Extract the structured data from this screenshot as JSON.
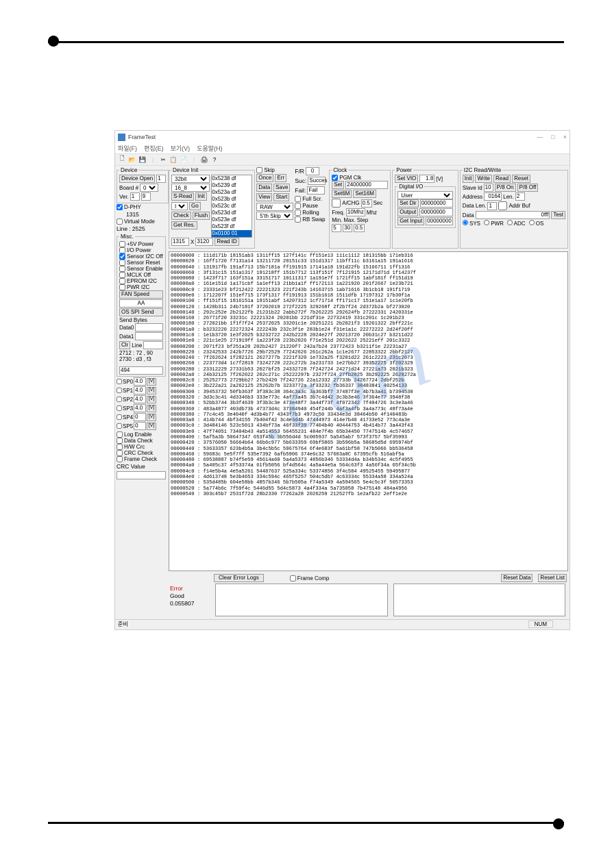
{
  "window": {
    "title": "FrameTest",
    "menus": [
      "파일(F)",
      "편집(E)",
      "보기(V)",
      "도움말(H)"
    ],
    "win_buttons": [
      "—",
      "□",
      "×"
    ]
  },
  "device": {
    "legend": "Device",
    "open_btn": "Device Open",
    "open_val": "1",
    "board_label": "Board #",
    "board_val": "0",
    "ver_label": "Ver.",
    "ver_val1": "1",
    "ver_val2": "9"
  },
  "dphy": {
    "cb_dphy": "D-PHY",
    "val_1315": "1315",
    "cb_virtual": "Virtual Mode",
    "line_label": "Line :",
    "line_val": "2525"
  },
  "misc": {
    "legend": "Misc.",
    "items": [
      "+5V Power",
      "I/O Power",
      "Sensor I2C Off",
      "Sensor Reset",
      "Sensor Enable",
      "MCLK Off",
      "EPROM I2C",
      "PWR I2C"
    ],
    "checked_index": 2,
    "fan_label": "FAN Speed",
    "fan_val": "AA",
    "os_spi_btn": "OS SPI Send",
    "send_bytes_label": "Send Bytes",
    "data0_label": "Data0",
    "data1_label": "Data1",
    "clr_btn": "Clr",
    "line_label": "Line",
    "note1": "2712 : 72 , 90",
    "note2": "2730 : d3 , f3",
    "note3": "494"
  },
  "sp": {
    "rows": [
      {
        "name": "SP0",
        "val": "4.0"
      },
      {
        "name": "SP1",
        "val": "4.0"
      },
      {
        "name": "SP2",
        "val": "4.0"
      },
      {
        "name": "SP3",
        "val": "4.0"
      },
      {
        "name": "SP4",
        "val": "0"
      },
      {
        "name": "SP5",
        "val": "0"
      }
    ],
    "vbtn": "[V]"
  },
  "checks2": {
    "items": [
      "Log Enable",
      "Data Check",
      "H/W Crc",
      "CRC Check",
      "Frame Check"
    ],
    "crc_label": "CRC Value"
  },
  "device_init": {
    "legend": "Device Init",
    "bit_sel": "32bit",
    "fmt_sel": "16_8",
    "sread_btn": "S-Read",
    "init_btn": "Init",
    "ini_sel": "INI",
    "go_btn": "Go",
    "check_btn": "Check",
    "flush_btn": "Flush",
    "getres_btn": "Get Res.",
    "res_w": "1315",
    "res_x": "X",
    "res_h": "3120",
    "list_items": [
      "0x5238 df",
      "0x5239 df",
      "0x523a df",
      "0x523b df",
      "0x523c df",
      "0x523d df",
      "0x523e df",
      "0x523f df",
      "0x0100 01"
    ],
    "readid_btn": "Read ID"
  },
  "mid_controls": {
    "skip_cb": "Skip",
    "once_btn": "Once",
    "err_btn": "Err",
    "data_btn": "Data",
    "save_btn": "Save",
    "view_btn": "View",
    "start_btn": "Start",
    "raw_sel": "RAW",
    "sth_sel": "5'th Skip",
    "fr_label": "F/R",
    "fr_val": "0",
    "suc_label": "Suc:",
    "suc_val": "Succes",
    "fail_label": "Fail:",
    "fail_val": "Fail",
    "fullscr": "Full Scr.",
    "pause": "Pause",
    "rolling": "Rolling",
    "rbswap": "RB Swap"
  },
  "clock": {
    "legend": "Clock",
    "pgmclk": "PGM Clk",
    "set_btn": "Set",
    "set_val": "24000000",
    "set6m_btn": "Set6M",
    "set16m_btn": "Set16M",
    "achg_cb": "A/CHG",
    "achg_val": "0.5",
    "sec_label": "Sec",
    "freq_label": "Freq.",
    "freq_val": "10Mhz",
    "mhz_label": "Mhz",
    "min_label": "Min.",
    "max_label": "Max.",
    "step_label": "Step",
    "min_val": "5",
    "max_val": "30",
    "step_val": "0.5"
  },
  "power": {
    "legend": "Power",
    "setvio_btn": "Set VIO",
    "vio_val": "1.8",
    "v_label": "[V]",
    "digital_legend": "Digital I/O",
    "user_sel": "User",
    "setdir_btn": "Set Dir",
    "setdir_val": "00000000",
    "output_btn": "Output",
    "output_val": "00000000",
    "getinput_btn": "Get Input",
    "getinput_val": "00000000"
  },
  "i2c": {
    "legend": "I2C Read/Write",
    "init_btn": "Init",
    "write_btn": "Write",
    "read_btn": "Read",
    "reset_btn": "Reset",
    "slaveid_label": "Slave Id",
    "slaveid_val": "10",
    "p8on_btn": "P/8 On",
    "p8off_btn": "P/8 Off",
    "addr_label": "Address",
    "addr_val": "0164",
    "len_label": "Len.",
    "len_val": "2",
    "datalen_label": "Data Len.",
    "datalen_val": "1",
    "addrbuf_cb": "Addr Buf",
    "data_label": "Data",
    "data_val": "0fff",
    "test_btn": "Test",
    "radios": [
      "SYS",
      "PWR",
      "ADC",
      "OS"
    ]
  },
  "hex_dump": "00000000 : 111d171b 18151ab3 1311ff15 127f141c ff151e13 111c1112 181315bb 171eb316\n00000020 : 16ff1720 f7131a14 13211720 20151c33 151d1317 11bff11c b3161a15 191a1616\n00000040 : 131917fb 191af713 15b7181a ff191915 17141a18 191d22fb 15166711 1ff1316\n00000060 : 3f131c15 151a1317 191218ff 151b7712 113f151f 7f121915 12171d71d 1f14237f\n00000080 : 1423f717 163f151a 33151717 10111317 1a191e7f 1721ff15 1abf181f ff151d19\n000000a0 : 161e151d 1a171cbf 1a1eff13 21bb1a1f ff172113 1a221920 201f2667 1e23b721\n000000c0 : 23331e23 bf212422 22221323 221f243b 14163715 1ab71616 3b1cb18 191f1719\n000000e0 : 1712207f 151ef715 173f1317 ff191913 151b1618 1511dfb 17197312 17b30f1a\n00000100 : ff151f15 1816151a 19151abf 14207312 1cf71714 ff171c17 151e1a17 1c1e20fb\n00000120 : 1420b311 24b7181f 37202019 272f2225 329268f 2f2b7f24 2d372b2a bf273020\n00000140 : 292c252e 2b2122fb 21231b22 2abb272f 7b262225 292624fb 27222331 2420331e\n00000160 : 26771f20 33231c 22221324 20201bb 221df31e 22732419 331c201c 1c201b23\n00000180 : 272021bb 1f1f7f24 25372025 33201c1e 20251221 2b2021f3 19261322 2bff221c\n000001a0 : b3232220 22272324 222243b 232c3f1e 283b1e24 f31e1a1c 22272222 2d24f20ff\n000001c0 : 1e1b3720 1e3f2025 b3232722 242b2228 2024e27f 20213720 20b31c27 b3211d22\n000001e0 : 221c1e25 271919ff 1a223f20 223b2026 f71e251d 2022622 25221eff 201c3322\n00000200 : 2071f23 bf251a20 202b2427 21220f7 242a7b24 23772423 b3211f1e 22231a27\n00000220 : 23242533 242b7726 29b72529 77242626 261c262a 1c1e2677 22853322 2bbf2127\n00000240 : 7f262624 1f282121 2627277b 2221f320 1e732a25 f3201d22 261c2223 231c2073\n00000260 : 223773d4 1c7f2819 73242720 222c272b 2a231733 1e27bb27 39352225 3f202329\n00000280 : 23312229 27331b53 2027bf25 24332728 7f242724 24271d24 27221a73 2021b323\n000002a0 : 24b32125 7f262022 202c271c 25222297b 2327f724 27fb2025 3b292225 2628272a\n000002c0 : 25252773 2729bb27 27b2420 7f242726 22a12332 27733b 24267724 2dbf252b\n000002e0 : 3b222a21 2a262125 25262b7b 3233772a 3f33232 fb36337 38483841 40254133\n00000300 : 39453732 50fb363f 3f383c38 364c3a3c 3a363bf7 37487f3e 4b7b3a41 b7394530\n00000320 : 3d3c3c41 4d3346b3 333e773c 4af73a45 3b7c4d42 3c3b3e46 3f364e77 3948f38\n00000340 : 52bb3744 3b3f4639 3f3b3c3e 473e48f7 3a44f73f 4f072342 7f404726 3c3e3a46\n00000360 : 483a4877 403db73b 47373d4c 37384940 454f244b 4af3a4fb 3a4a773c 48f73a4e\n00000380 : 77c4c45 3e4040f 4d3b4b77 4343f7b3 4973c50 33434e3d 38464b50 4f140483b\n000003a0 : 414b744 4bf34155 7b404f42 3c4e3d4b 47444973 414e7b40 41733e52 773c4a3e\n000003c0 : 3d484146 523c5013 434bf73a 46f33f39 77404b40 40444753 4b414b77 3a443f43\n000003e0 : 47f74051 73404b43 4a514553 56455231 484e7f4b 65b34450 7747514b 4c574657\n00000400 : 5af5a3b 50647347 653f45b 3b556d4d 5c005937 5a545ab7 573f3757 5bf35993\n00000420 : 37576050 56664b64 66b6c977 5b633359 69bf5865 3b596b5a 58685d5d 695974bf\n00000440 : 53633357 623b4b5a 3b4c5b5c 59675764 6f4e683f 5a61bf58 747b5066 bb536458\n00000460 : 59683c 5e5f7ff 535e7392 6afb5906 374e6c32 57603a8C 67395cfb 516abf5a\n00000480 : 69538887 b74f5e59 45614a60 5a4a5373 4856b346 53334d4a b34b534c 4c5f4955\n000004a0 : 5a405c37 4f53374a 61fb5056 bf4d564c 4a5a44e5a 564c63f3 4a56f34a 65f34c5b\n000004c0 : f14e5b4a 4e5a5261 54487637 525a334c 53374856 3f4c584 49525455 59495877\n000004e0 : 4d613748 5e3b4653 334c594c 465f5257 504c5db7 4c63334c 55334a58 334a524a\n00000500 : 535d485b 604e58bb 4857b346 5b7b505a f74a5349 4a594565 5e4c5c3f 50573353\n00000520 : 5a774b6c 7f59f4c 5446d55 5d4c5873 4a4f334a 5a735058 7b475148 484a4956\n00000540 : 303c45b7 2531f72d 28b2330 77262a28 2026259 212527fb 1e2afb22 2eff1e2e",
  "bottom": {
    "clear_btn": "Clear Error Logs",
    "framecomp_cb": "Frame Comp",
    "resetdata_btn": "Reset Data",
    "resetlist_btn": "Reset List"
  },
  "errgood": {
    "error_label": "Error",
    "good_label": "Good",
    "good_val": "0.055807"
  },
  "status": {
    "ready": "준비",
    "num": "NUM"
  },
  "watermark_text": ".com"
}
